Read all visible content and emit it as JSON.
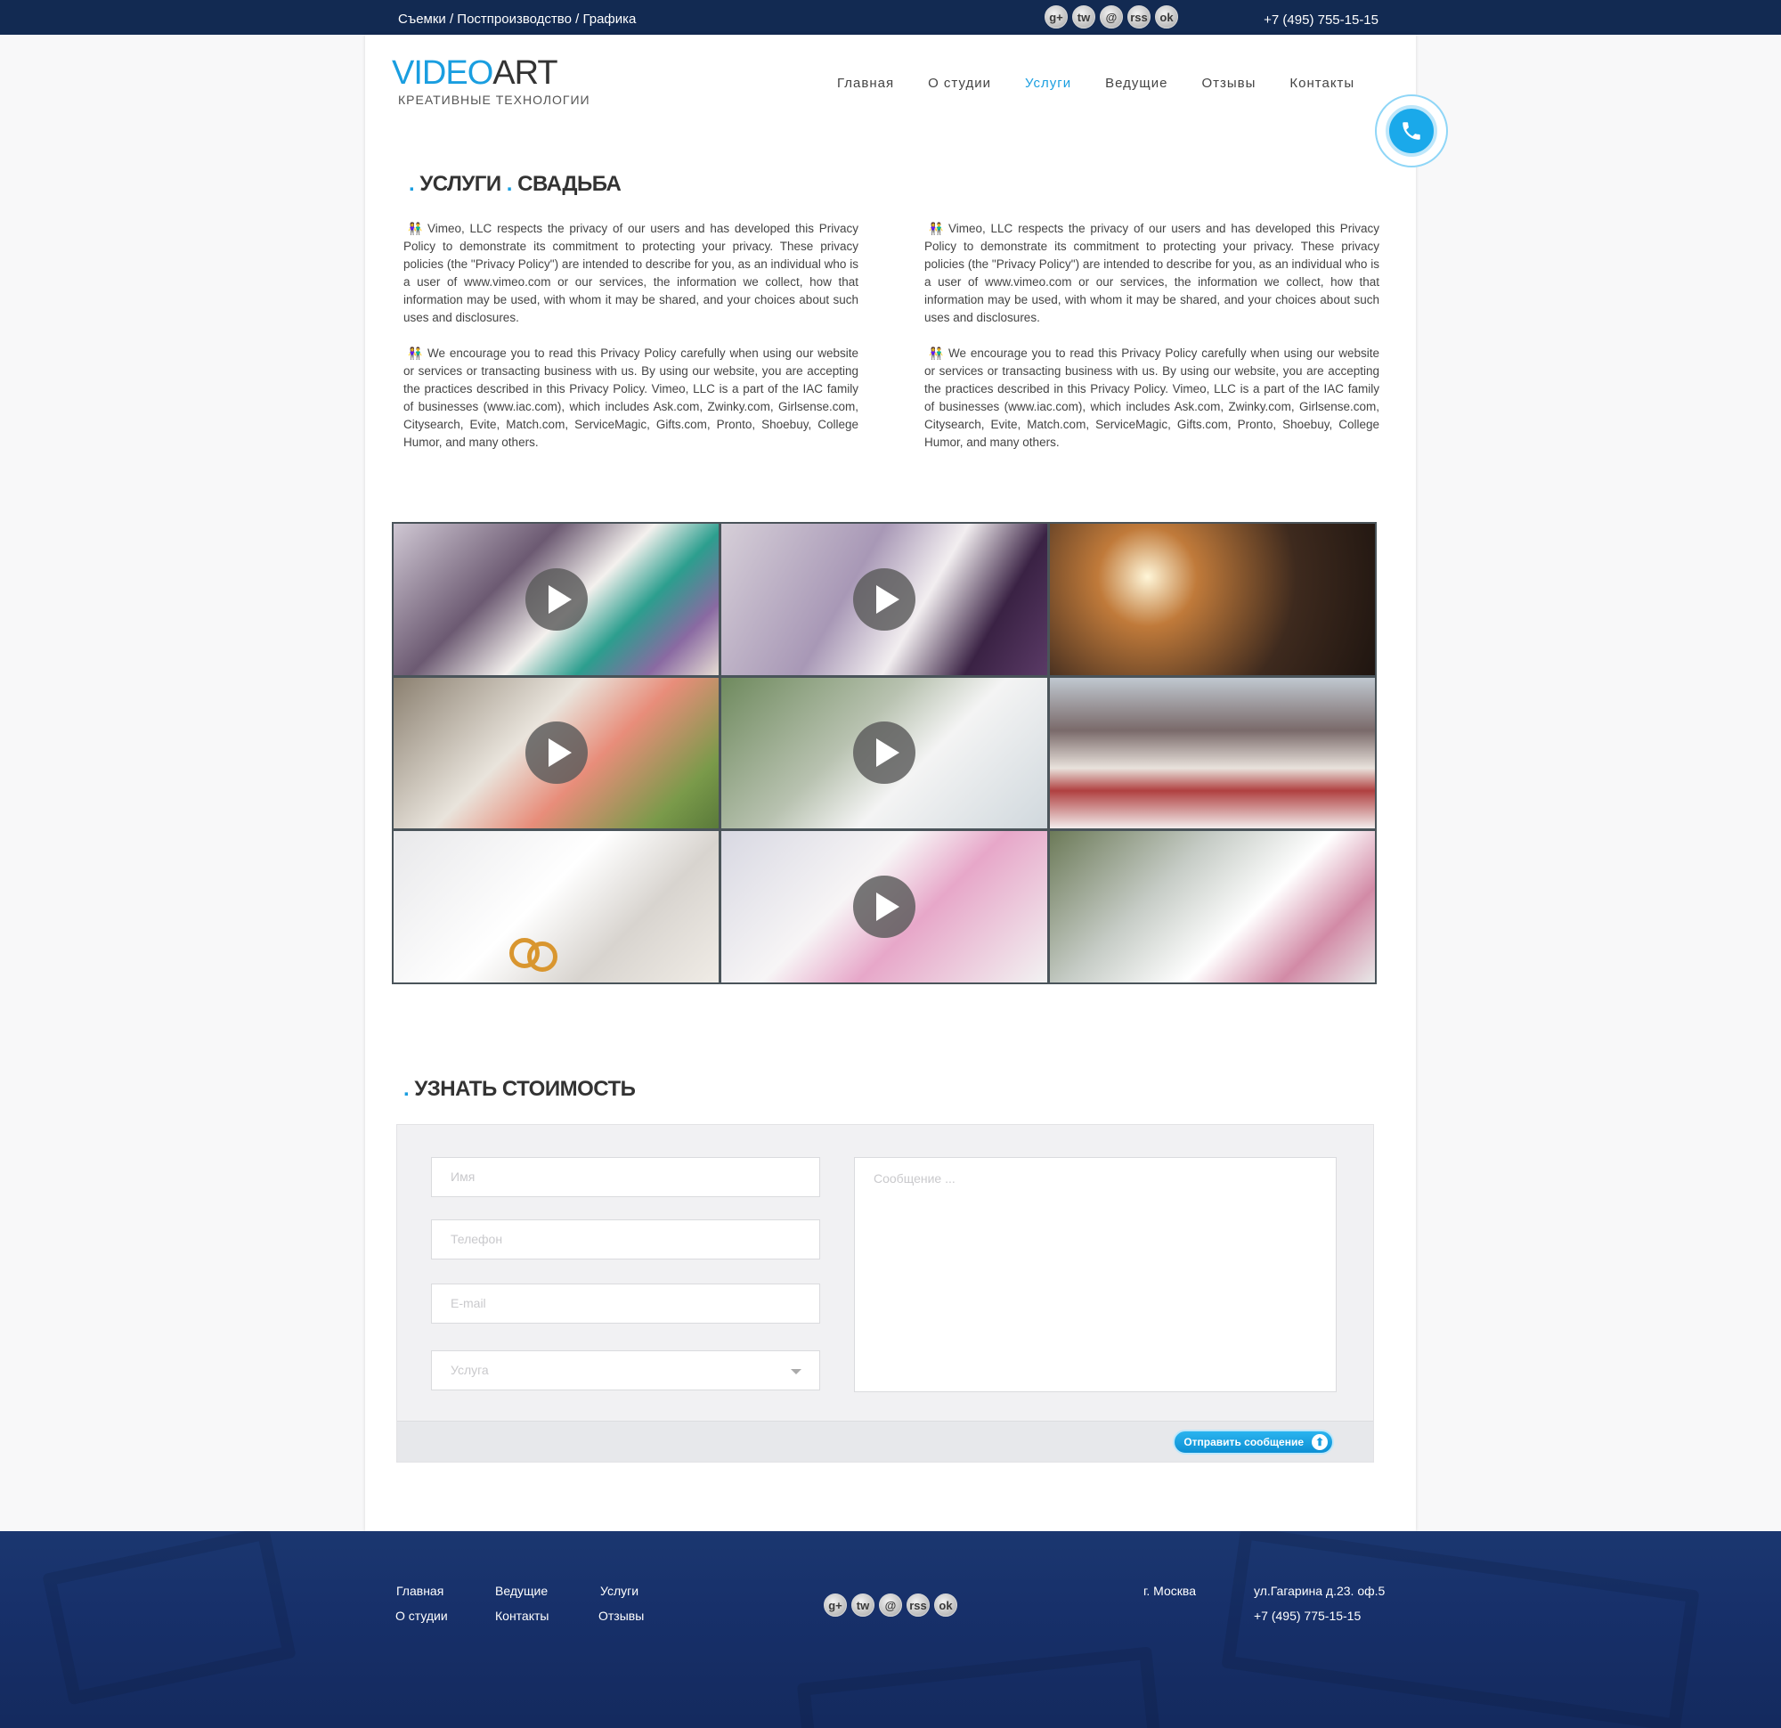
{
  "topbar": {
    "tagline": "Съемки / Постпроизводство / Графика",
    "phone": "+7 (495) 755-15-15",
    "social": [
      "g+",
      "tw",
      "@",
      "rss",
      "ok"
    ]
  },
  "logo": {
    "video": "VIDEO",
    "art": "ART",
    "subtitle": "КРЕАТИВНЫЕ ТЕХНОЛОГИИ"
  },
  "nav": [
    {
      "label": "Главная"
    },
    {
      "label": "О студии"
    },
    {
      "label": "Услуги"
    },
    {
      "label": "Ведущие"
    },
    {
      "label": "Отзывы"
    },
    {
      "label": "Контакты"
    }
  ],
  "nav_active": "Услуги",
  "heading": {
    "part1": "УСЛУГИ",
    "part2": "СВАДЬБА"
  },
  "content": {
    "left": [
      "Vimeo, LLC respects the privacy of our users and has developed this Privacy Policy to demonstrate its commitment to protecting your privacy. These privacy policies (the \"Privacy Policy\") are intended to describe for you, as an individual who is a user of www.vimeo.com or our services, the information we collect, how that information may be used, with whom it may be shared, and your choices about such uses and disclosures.",
      "We encourage you to read this Privacy Policy carefully when using our website or services or transacting business with us. By using our website, you are accepting the practices described in this Privacy Policy. Vimeo, LLC is a part of the IAC family of businesses (www.iac.com), which includes Ask.com, Zwinky.com, Girlsense.com, Citysearch, Evite, Match.com, ServiceMagic, Gifts.com, Pronto, Shoebuy, College Humor, and many others."
    ],
    "right": [
      "Vimeo, LLC respects the privacy of our users and has developed this Privacy Policy to demonstrate its commitment to protecting your privacy. These privacy policies (the \"Privacy Policy\") are intended to describe for you, as an individual who is a user of www.vimeo.com or our services, the information we collect, how that information may be used, with whom it may be shared, and your choices about such uses and disclosures.",
      "We encourage you to read this Privacy Policy carefully when using our website or services or transacting business with us. By using our website, you are accepting the practices described in this Privacy Policy. Vimeo, LLC is a part of the IAC family of businesses (www.iac.com), which includes Ask.com, Zwinky.com, Girlsense.com, Citysearch, Evite, Match.com, ServiceMagic, Gifts.com, Pronto, Shoebuy, College Humor, and many others."
    ]
  },
  "gallery": [
    {
      "play": true
    },
    {
      "play": true
    },
    {
      "play": false
    },
    {
      "play": true
    },
    {
      "play": true
    },
    {
      "play": false
    },
    {
      "play": false
    },
    {
      "play": true
    },
    {
      "play": false
    }
  ],
  "form": {
    "title": "УЗНАТЬ СТОИМОСТЬ",
    "name_placeholder": "Имя",
    "phone_placeholder": "Телефон",
    "email_placeholder": "E-mail",
    "service_placeholder": "Услуга",
    "message_placeholder": "Сообщение ...",
    "submit_label": "Отправить сообщение"
  },
  "footer": {
    "links": {
      "home": "Главная",
      "hosts": "Ведущие",
      "services": "Услуги",
      "about": "О студии",
      "contacts": "Контакты",
      "reviews": "Отзывы"
    },
    "city": "г. Москва",
    "address": "ул.Гагарина д.23. оф.5",
    "phone": "+7 (495) 775-15-15"
  },
  "colors": {
    "accent": "#1a9ee0",
    "topbar": "#122a52",
    "footer": "#17306a"
  }
}
